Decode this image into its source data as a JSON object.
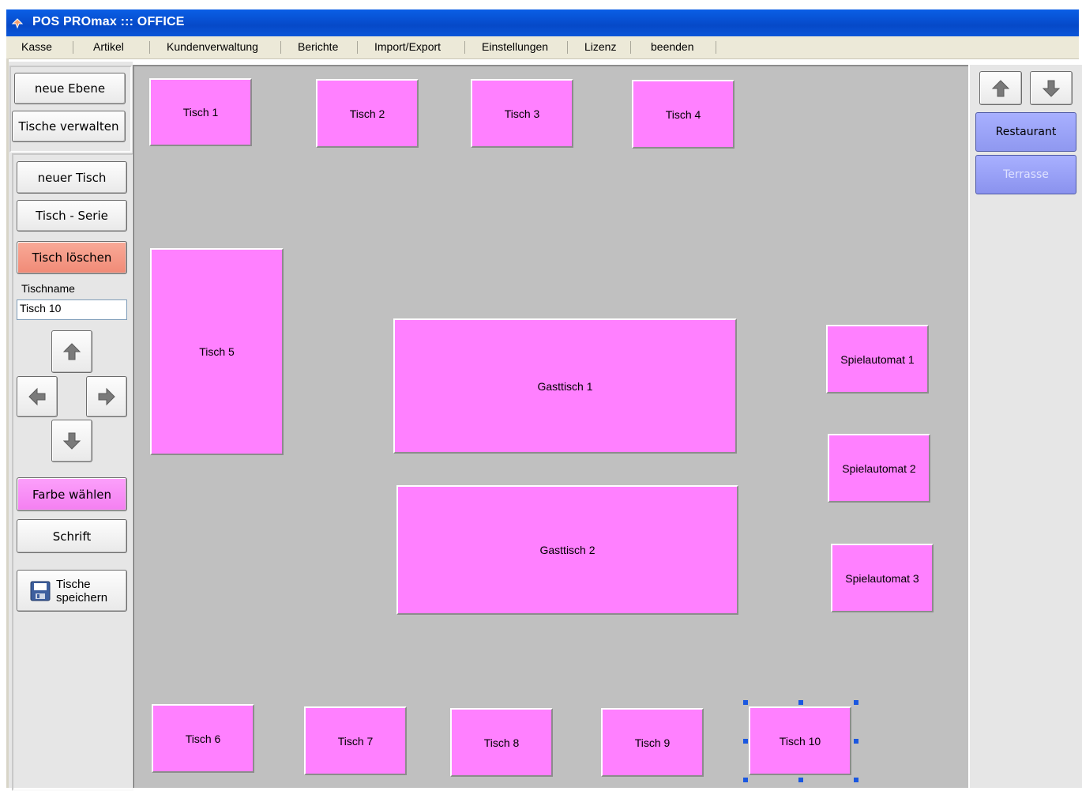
{
  "window": {
    "title": "POS PROmax ::: OFFICE"
  },
  "menu": [
    {
      "label": "Kasse"
    },
    {
      "label": "Artikel"
    },
    {
      "label": "Kundenverwaltung"
    },
    {
      "label": "Berichte"
    },
    {
      "label": "Import/Export"
    },
    {
      "label": "Einstellungen"
    },
    {
      "label": "Lizenz"
    },
    {
      "label": "beenden"
    }
  ],
  "left": {
    "neue_ebene": "neue Ebene",
    "tische_verwalten": "Tische verwalten",
    "neuer_tisch": "neuer Tisch",
    "tisch_serie": "Tisch - Serie",
    "tisch_loeschen": "Tisch löschen",
    "tischname_label": "Tischname",
    "tischname_value": "Tisch 10",
    "farbe_waehlen": "Farbe wählen",
    "schrift": "Schrift",
    "tische_speichern": "Tische speichern",
    "arrow_icons": [
      "arrow-up-icon",
      "arrow-left-icon",
      "arrow-right-icon",
      "arrow-down-icon"
    ]
  },
  "tables": [
    {
      "label": "Tisch 1"
    },
    {
      "label": "Tisch 2"
    },
    {
      "label": "Tisch 3"
    },
    {
      "label": "Tisch 4"
    },
    {
      "label": "Tisch 5"
    },
    {
      "label": "Gasttisch 1"
    },
    {
      "label": "Gasttisch 2"
    },
    {
      "label": "Spielautomat 1"
    },
    {
      "label": "Spielautomat 2"
    },
    {
      "label": "Spielautomat 3"
    },
    {
      "label": "Tisch 6"
    },
    {
      "label": "Tisch 7"
    },
    {
      "label": "Tisch 8"
    },
    {
      "label": "Tisch 9"
    },
    {
      "label": "Tisch 10",
      "selected": true
    }
  ],
  "right": {
    "layers": [
      {
        "label": "Restaurant",
        "active": true
      },
      {
        "label": "Terrasse",
        "active": false
      }
    ]
  },
  "colors": {
    "table": "#ff80ff",
    "canvas": "#c0c0c0",
    "titlebar": "#0649c8",
    "delete": "#f08a76",
    "layer": "#9ba3f5"
  }
}
